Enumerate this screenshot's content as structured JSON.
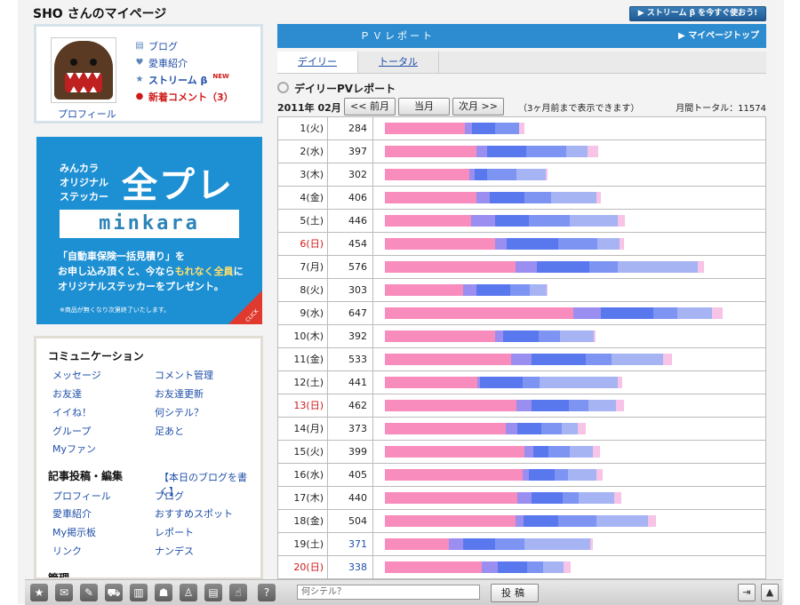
{
  "header": {
    "title": "SHO さんのマイページ",
    "stream_button": "▶ ストリーム β を今すぐ使おう!"
  },
  "profile": {
    "profile_link": "プロフィール",
    "links": [
      {
        "label": "ブログ",
        "icon": "document-icon"
      },
      {
        "label": "愛車紹介",
        "icon": "heart-icon"
      },
      {
        "label": "ストリーム β",
        "icon": "star-icon",
        "badge": "NEW"
      },
      {
        "label": "新着コメント（3）",
        "icon": "comment-icon"
      }
    ]
  },
  "banner": {
    "small_lines": [
      "みんカラ",
      "オリジナル",
      "ステッカー"
    ],
    "big_text": "全プレ",
    "logo": "minkara",
    "text_line1": "「自動車保険一括見積り」を",
    "text_line2_a": "お申し込み頂くと、今なら",
    "text_line2_b": "もれなく全員",
    "text_line2_c": "に",
    "text_line3": "オリジナルステッカーをプレゼント。",
    "note": "※商品が無くなり次第終了いたします。",
    "corner": "CLICK"
  },
  "menu": {
    "communication_title": "コミュニケーション",
    "communication_links": [
      "メッセージ",
      "コメント管理",
      "お友達",
      "お友達更新",
      "イイね！",
      "何シテル？",
      "グループ",
      "足あと",
      "Myファン"
    ],
    "post_title": "記事投稿・編集",
    "post_action": "【本日のブログを書く】",
    "post_links": [
      "プロフィール",
      "ブログ",
      "愛車紹介",
      "おすすめスポット",
      "My掲示板",
      "レポート",
      "リンク",
      "ナンデス"
    ],
    "admin_title": "管理"
  },
  "pv": {
    "header_title": "ＰＶレポート",
    "top_link": "▶ マイページトップ",
    "tabs": [
      "デイリー",
      "トータル"
    ],
    "section_title": "デイリーPVレポート",
    "month_label": "2011年 02月",
    "prev_button": "<< 前月",
    "current_button": "当月",
    "next_button": "次月 >>",
    "nav_note": "（3ヶ月前まで表示できます）",
    "month_total": "月間トータル：11574"
  },
  "colors": {
    "pink": "#f88cbc",
    "purple": "#9a8ef0",
    "blue": "#5a78ee",
    "mid": "#7d94f2",
    "light": "#a7b4f4",
    "green": "#a8e6a6",
    "lpink": "#f7c3e6"
  },
  "chart_data": {
    "type": "bar",
    "orientation": "horizontal-stacked",
    "max_value": 700,
    "rows": [
      {
        "day": "1(火)",
        "value": 284,
        "sunday": false,
        "segments": [
          0.52,
          0.05,
          0.15,
          0.16,
          0.0,
          0.03
        ]
      },
      {
        "day": "2(水)",
        "value": 397,
        "sunday": false,
        "segments": [
          0.43,
          0.05,
          0.18,
          0.19,
          0.1,
          0.05
        ]
      },
      {
        "day": "3(木)",
        "value": 302,
        "sunday": false,
        "segments": [
          0.52,
          0.03,
          0.08,
          0.18,
          0.18,
          0.01
        ]
      },
      {
        "day": "4(金)",
        "value": 406,
        "sunday": false,
        "segments": [
          0.42,
          0.06,
          0.16,
          0.12,
          0.21,
          0.02
        ]
      },
      {
        "day": "5(土)",
        "value": 446,
        "sunday": false,
        "segments": [
          0.36,
          0.1,
          0.14,
          0.17,
          0.2,
          0.03
        ]
      },
      {
        "day": "6(日)",
        "value": 454,
        "sunday": true,
        "segments": [
          0.45,
          0.05,
          0.21,
          0.16,
          0.09,
          0.02
        ]
      },
      {
        "day": "7(月)",
        "value": 576,
        "sunday": false,
        "segments": [
          0.42,
          0.07,
          0.17,
          0.09,
          0.26,
          0.02
        ]
      },
      {
        "day": "8(火)",
        "value": 303,
        "sunday": false,
        "segments": [
          0.48,
          0.08,
          0.21,
          0.12,
          0.1,
          0.01
        ]
      },
      {
        "day": "9(水)",
        "value": 647,
        "sunday": false,
        "segments": [
          0.54,
          0.08,
          0.15,
          0.07,
          0.1,
          0.03
        ]
      },
      {
        "day": "10(木)",
        "value": 392,
        "sunday": false,
        "segments": [
          0.52,
          0.04,
          0.17,
          0.1,
          0.16,
          0.01
        ]
      },
      {
        "day": "11(金)",
        "value": 533,
        "sunday": false,
        "segments": [
          0.44,
          0.07,
          0.19,
          0.09,
          0.18,
          0.03
        ]
      },
      {
        "day": "12(土)",
        "value": 441,
        "sunday": false,
        "segments": [
          0.39,
          0.01,
          0.18,
          0.07,
          0.33,
          0.02
        ]
      },
      {
        "day": "13(日)",
        "value": 462,
        "sunday": true,
        "segments": [
          0.53,
          0.06,
          0.15,
          0.08,
          0.11,
          0.03
        ]
      },
      {
        "day": "14(月)",
        "value": 373,
        "sunday": false,
        "segments": [
          0.6,
          0.06,
          0.12,
          0.1,
          0.08,
          0.04
        ]
      },
      {
        "day": "15(火)",
        "value": 399,
        "sunday": false,
        "segments": [
          0.65,
          0.04,
          0.07,
          0.1,
          0.11,
          0.03
        ]
      },
      {
        "day": "16(水)",
        "value": 405,
        "sunday": false,
        "segments": [
          0.63,
          0.03,
          0.12,
          0.06,
          0.13,
          0.03
        ]
      },
      {
        "day": "17(木)",
        "value": 440,
        "sunday": false,
        "segments": [
          0.56,
          0.06,
          0.13,
          0.07,
          0.15,
          0.03
        ]
      },
      {
        "day": "18(金)",
        "value": 504,
        "sunday": false,
        "segments": [
          0.48,
          0.03,
          0.13,
          0.14,
          0.19,
          0.03
        ]
      },
      {
        "day": "19(土)",
        "value": 371,
        "sunday": false,
        "segments": [
          0.32,
          0.07,
          0.16,
          0.15,
          0.33,
          0.01
        ]
      },
      {
        "day": "20(日)",
        "value": 338,
        "sunday": true,
        "segments": [
          0.53,
          0.09,
          0.16,
          0.09,
          0.11,
          0.04
        ]
      }
    ]
  },
  "toolbar": {
    "icons": [
      "star-icon",
      "mail-icon",
      "pen-icon",
      "car-icon",
      "chart-icon",
      "group-icon",
      "user-icon",
      "card-icon",
      "thumbs-up-icon",
      "question-icon"
    ],
    "input_placeholder": "何シテル？",
    "post_button": "投稿",
    "right_buttons": [
      "⇥",
      "▲"
    ]
  }
}
